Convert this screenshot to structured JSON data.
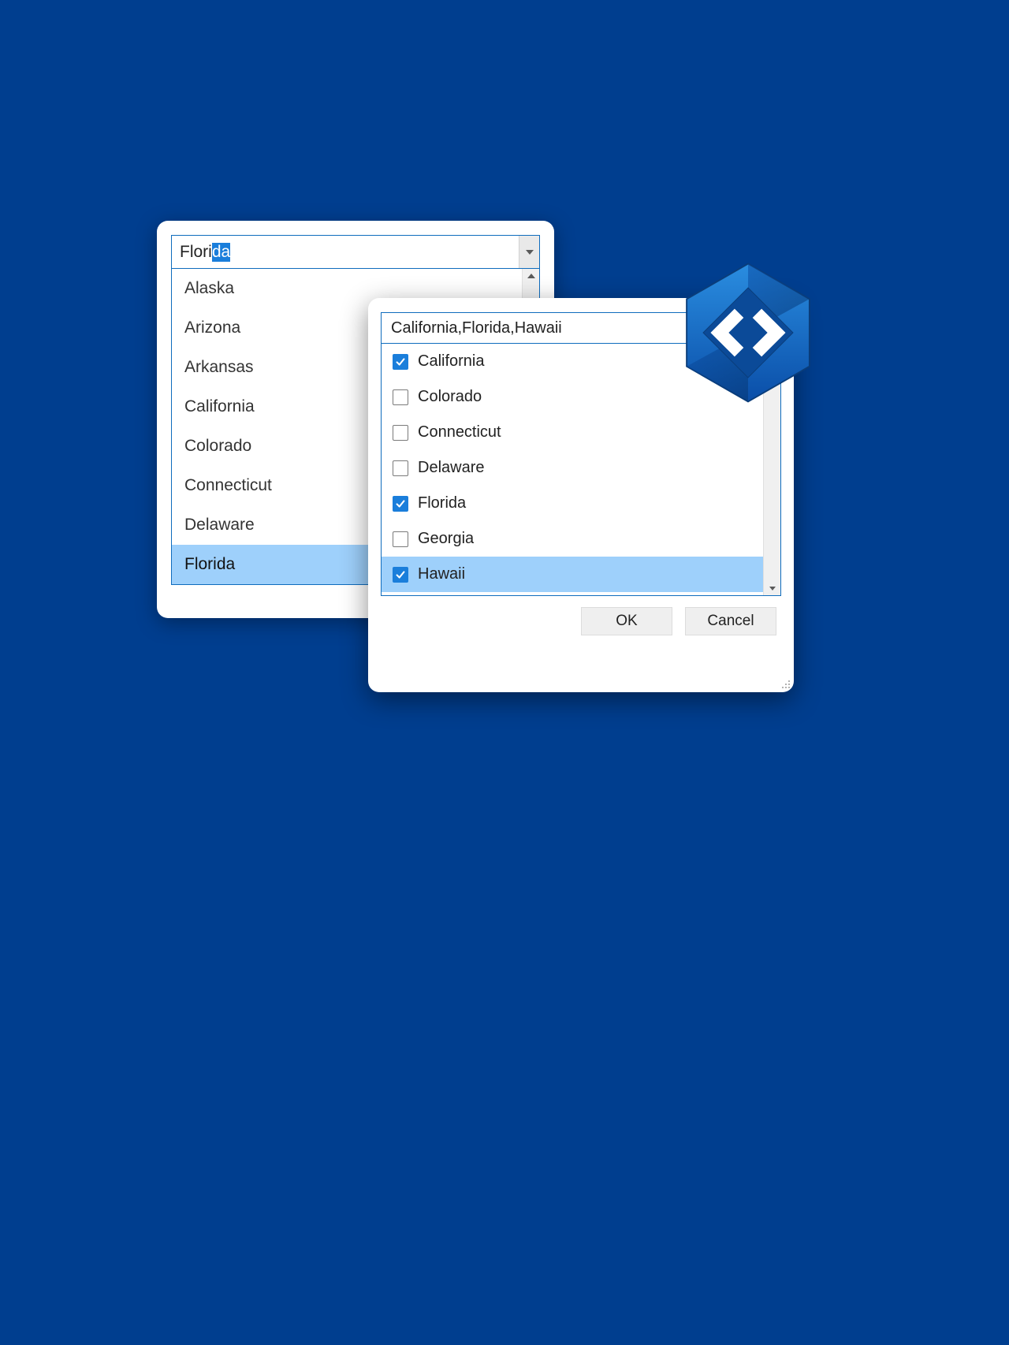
{
  "colors": {
    "background": "#003e8f",
    "accent": "#0f6cbd",
    "highlight": "#9ed0fb",
    "checkbox_fill": "#1a7edb"
  },
  "single_combo": {
    "typed_text": "Flori",
    "suggested_suffix": "da",
    "items": [
      {
        "label": "Alaska",
        "selected": false
      },
      {
        "label": "Arizona",
        "selected": false
      },
      {
        "label": "Arkansas",
        "selected": false
      },
      {
        "label": "California",
        "selected": false
      },
      {
        "label": "Colorado",
        "selected": false
      },
      {
        "label": "Connecticut",
        "selected": false
      },
      {
        "label": "Delaware",
        "selected": false
      },
      {
        "label": "Florida",
        "selected": true
      }
    ]
  },
  "multi_combo": {
    "display_text": "California,Florida,Hawaii",
    "items": [
      {
        "label": "California",
        "checked": true,
        "hover": false
      },
      {
        "label": "Colorado",
        "checked": false,
        "hover": false
      },
      {
        "label": "Connecticut",
        "checked": false,
        "hover": false
      },
      {
        "label": "Delaware",
        "checked": false,
        "hover": false
      },
      {
        "label": "Florida",
        "checked": true,
        "hover": false
      },
      {
        "label": "Georgia",
        "checked": false,
        "hover": false
      },
      {
        "label": "Hawaii",
        "checked": true,
        "hover": true
      }
    ],
    "buttons": {
      "ok": "OK",
      "cancel": "Cancel"
    }
  }
}
